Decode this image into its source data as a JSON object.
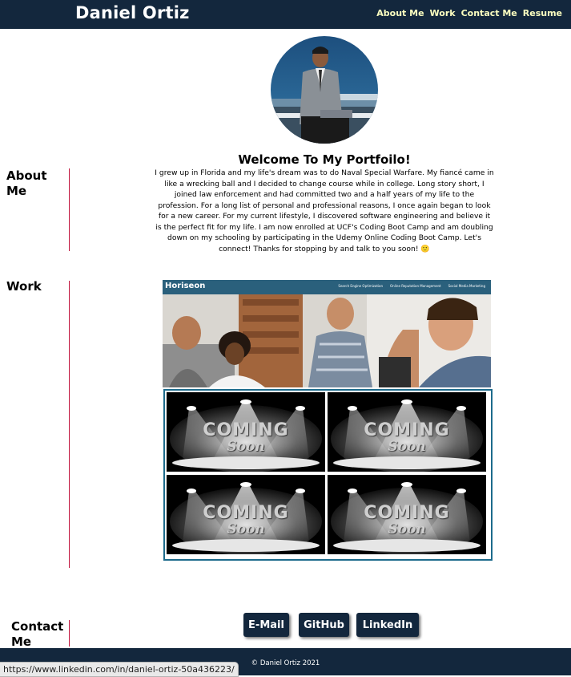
{
  "header": {
    "site_title": "Daniel Ortiz",
    "nav": [
      "About Me",
      "Work",
      "Contact Me",
      "Resume"
    ]
  },
  "about": {
    "label": "About Me",
    "welcome_heading": "Welcome To My Portfoilo!",
    "bio": "I grew up in Florida and my life's dream was to do Naval Special Warfare. My fiancé came in like a wrecking ball and I decided to change course while in college. Long story short, I joined law enforcement and had committed two and a half years of my life to the profession. For a long list of personal and professional reasons, I once again began to look for a new career. For my current lifestyle, I discovered software engineering and believe it is the perfect fit for my life. I am now enrolled at UCF's Coding Boot Camp and am doubling down on my schooling by participating in the Udemy Online Coding Boot Camp. Let's connect! Thanks for stopping by and talk to you soon! 🙂"
  },
  "work": {
    "label": "Work",
    "featured": {
      "brand": "Horiseon",
      "nav": [
        "Search Engine Optimization",
        "Online Reputation Management",
        "Social Media Marketing"
      ]
    },
    "placeholders": [
      {
        "line1": "COMING",
        "line2": "Soon"
      },
      {
        "line1": "COMING",
        "line2": "Soon"
      },
      {
        "line1": "COMING",
        "line2": "Soon"
      },
      {
        "line1": "COMING",
        "line2": "Soon"
      }
    ]
  },
  "contact": {
    "label": "Contact Me",
    "buttons": [
      "E-Mail",
      "GitHub",
      "LinkedIn"
    ]
  },
  "footer": {
    "text": "© Daniel Ortiz 2021"
  },
  "status_bar": {
    "url": "https://www.linkedin.com/in/daniel-ortiz-50a436223/"
  },
  "colors": {
    "nav_bg": "#13273d",
    "nav_link": "#fcffc0",
    "divider": "#c0143c",
    "frame": "#1d6b8c"
  }
}
